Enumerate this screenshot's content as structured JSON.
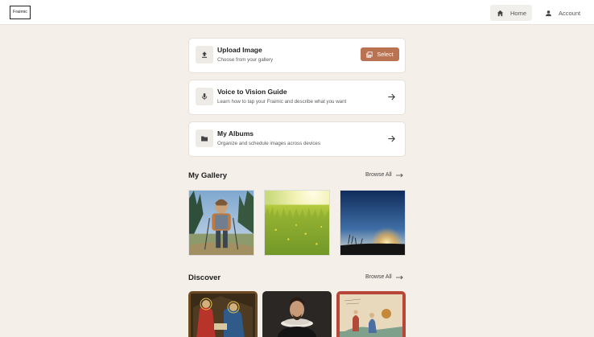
{
  "header": {
    "logo_text": "Fraimic",
    "nav": [
      {
        "label": "Home",
        "icon": "home-icon"
      },
      {
        "label": "Account",
        "icon": "person-icon"
      }
    ]
  },
  "cards": [
    {
      "title": "Upload Image",
      "subtitle": "Choose from your gallery",
      "icon": "upload-icon",
      "action_label": "Select"
    },
    {
      "title": "Voice to Vision Guide",
      "subtitle": "Learn how to tap your Fraimic and describe what you want",
      "icon": "microphone-icon"
    },
    {
      "title": "My Albums",
      "subtitle": "Organize and schedule images across devices",
      "icon": "folder-icon"
    }
  ],
  "gallery": {
    "title": "My Gallery",
    "browse_label": "Browse All",
    "items": [
      "hiker-photo",
      "meadow-photo",
      "sunset-photo"
    ]
  },
  "discover": {
    "title": "Discover",
    "browse_label": "Browse All",
    "items": [
      "nativity-painting",
      "portrait-painting",
      "manuscript-painting"
    ]
  },
  "colors": {
    "background": "#f4efe9",
    "accent": "#b97352",
    "card": "#ffffff"
  }
}
